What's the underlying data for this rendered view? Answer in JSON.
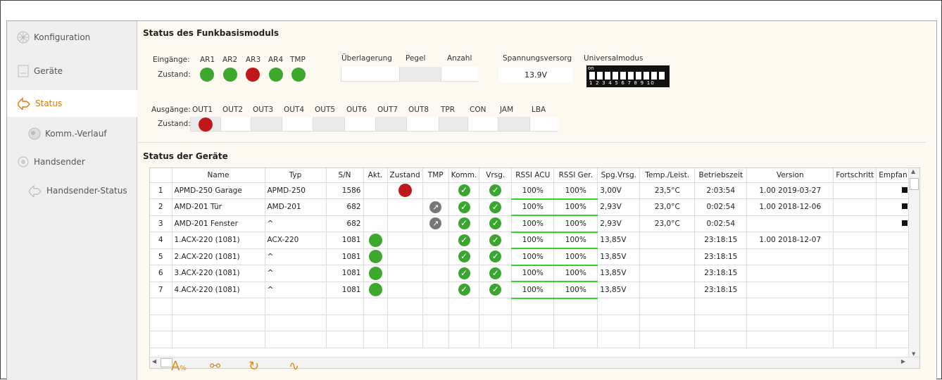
{
  "sidebar": {
    "items": [
      {
        "label": "Konfiguration",
        "icon": "snowflake-icon"
      },
      {
        "label": "Geräte",
        "icon": "device-icon"
      },
      {
        "label": "Status",
        "icon": "status-icon"
      },
      {
        "label": "Komm.-Verlauf",
        "icon": "radio-icon"
      },
      {
        "label": "Handsender",
        "icon": "remote-icon"
      },
      {
        "label": "Handsender-Status",
        "icon": "remote-status-icon"
      }
    ]
  },
  "module": {
    "title": "Status des Funkbasismoduls",
    "inputs_label": "Eingänge:",
    "state_label": "Zustand:",
    "inputs": [
      "AR1",
      "AR2",
      "AR3",
      "AR4",
      "TMP"
    ],
    "input_states": [
      "green",
      "green",
      "red",
      "green",
      "green"
    ],
    "overlay_label": "Überlagerung",
    "level_label": "Pegel",
    "count_label": "Anzahl",
    "voltage_label": "Spannungsversorg",
    "voltage_value": "13.9V",
    "universal_label": "Universalmodus",
    "dip_on": "on",
    "dip_numbers": "1 2 3 4 5 6 7 8 9 10",
    "outputs_label": "Ausgänge:",
    "outputs": [
      "OUT1",
      "OUT2",
      "OUT3",
      "OUT4",
      "OUT5",
      "OUT6",
      "OUT7",
      "OUT8",
      "TPR",
      "CON",
      "JAM",
      "LBA"
    ],
    "output_states": [
      "red",
      "",
      "",
      "",
      "",
      "",
      "",
      "",
      "",
      "",
      "",
      ""
    ]
  },
  "devices": {
    "title": "Status der Geräte",
    "columns": [
      "Name",
      "Typ",
      "S/N",
      "Akt.",
      "Zustand",
      "TMP",
      "Komm.",
      "Vrsg.",
      "RSSI ACU",
      "RSSI Ger.",
      "Spg.Vrsg.",
      "Temp./Leist.",
      "Betriebszeit",
      "Version",
      "Fortschritt",
      "Empfan"
    ],
    "rows": [
      {
        "n": "1",
        "name": "APMD-250 Garage",
        "typ": "APMD-250",
        "sn": "1586",
        "akt": "",
        "zustand": "red",
        "tmp": "",
        "komm": "ok",
        "vrsg": "ok",
        "rssi_acu": "100%",
        "rssi_ger": "100%",
        "spg": "3,00V",
        "temp": "23,5°C",
        "zeit": "2:03:54",
        "version": "1.00 2019-03-27",
        "empf": "sq"
      },
      {
        "n": "2",
        "name": "AMD-201 Tür",
        "typ": "AMD-201",
        "sn": "682",
        "akt": "",
        "zustand": "",
        "tmp": "tmp",
        "komm": "ok",
        "vrsg": "ok",
        "rssi_acu": "100%",
        "rssi_ger": "100%",
        "spg": "2,93V",
        "temp": "23,0°C",
        "zeit": "0:02:54",
        "version": "1.00 2018-12-06",
        "empf": "sq"
      },
      {
        "n": "3",
        "name": "AMD-201 Fenster",
        "typ": "^",
        "sn": "682",
        "akt": "",
        "zustand": "",
        "tmp": "tmp",
        "komm": "ok",
        "vrsg": "ok",
        "rssi_acu": "100%",
        "rssi_ger": "100%",
        "spg": "2,93V",
        "temp": "23,0°C",
        "zeit": "0:02:54",
        "version": "",
        "empf": "sq"
      },
      {
        "n": "4",
        "name": "1.ACX-220 (1081)",
        "typ": "ACX-220",
        "sn": "1081",
        "akt": "green",
        "zustand": "",
        "tmp": "",
        "komm": "ok",
        "vrsg": "ok",
        "rssi_acu": "100%",
        "rssi_ger": "100%",
        "spg": "13,85V",
        "temp": "",
        "zeit": "23:18:15",
        "version": "1.00 2018-12-07",
        "empf": ""
      },
      {
        "n": "5",
        "name": "2.ACX-220 (1081)",
        "typ": "^",
        "sn": "1081",
        "akt": "green",
        "zustand": "",
        "tmp": "",
        "komm": "ok",
        "vrsg": "ok",
        "rssi_acu": "100%",
        "rssi_ger": "100%",
        "spg": "13,85V",
        "temp": "",
        "zeit": "23:18:15",
        "version": "",
        "empf": ""
      },
      {
        "n": "6",
        "name": "3.ACX-220 (1081)",
        "typ": "^",
        "sn": "1081",
        "akt": "green",
        "zustand": "",
        "tmp": "",
        "komm": "ok",
        "vrsg": "ok",
        "rssi_acu": "100%",
        "rssi_ger": "100%",
        "spg": "13,85V",
        "temp": "",
        "zeit": "23:18:15",
        "version": "",
        "empf": ""
      },
      {
        "n": "7",
        "name": "4.ACX-220 (1081)",
        "typ": "^",
        "sn": "1081",
        "akt": "green",
        "zustand": "",
        "tmp": "",
        "komm": "ok",
        "vrsg": "ok",
        "rssi_acu": "100%",
        "rssi_ger": "100%",
        "spg": "13,85V",
        "temp": "",
        "zeit": "23:18:15",
        "version": "",
        "empf": ""
      }
    ]
  },
  "toolbar": [
    "wizard-icon",
    "link-icon",
    "refresh-icon",
    "signal-icon"
  ]
}
